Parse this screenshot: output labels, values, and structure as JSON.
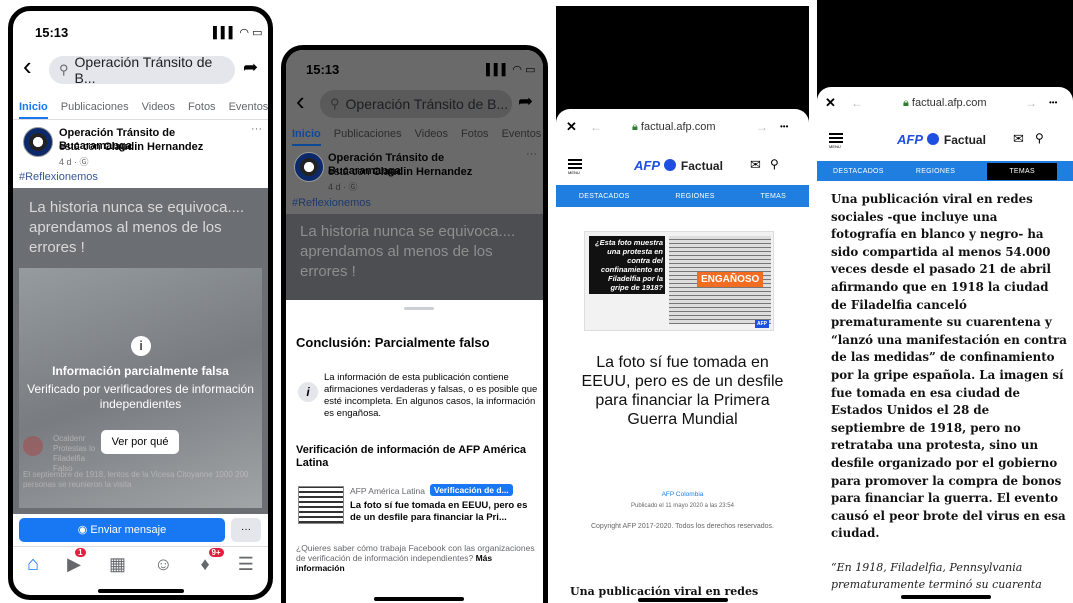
{
  "p1": {
    "time": "15:13",
    "status_icons": "▌▌▌ ◠ ▭",
    "back": "‹",
    "search": "Operación Tránsito de B...",
    "share": "➦",
    "tabs": [
      "Inicio",
      "Publicaciones",
      "Videos",
      "Fotos",
      "Eventos"
    ],
    "page_name": "Operación Tránsito de Bucaramanga",
    "with_prefix": "está con ",
    "with_name": "Claudin Hernandez",
    "meta": "4 d · Ⓖ",
    "more": "···",
    "hashtag": "#Reflexionemos",
    "post_text": "La historia nunca se equivoca.... aprendamos al menos de los errores !",
    "overlay_title": "Información parcialmente falsa",
    "overlay_sub": "Verificado por verificadores de información independientes",
    "see_why": "Ver por qué",
    "faded_1": "Ocaldenr Protestas lo Filadelfia Falso",
    "faded_2": "El septiembre de 1918, lentos de la Vicesa Citoyanne 1000 200 personas se reunieron la visita",
    "send_message": "Enviar mensaje",
    "send_more": "···",
    "badge1": "1",
    "badge2": "9+",
    "nav_icons": [
      "home-icon",
      "video-icon",
      "store-icon",
      "groups-icon",
      "bell-icon",
      "menu-icon"
    ]
  },
  "p2": {
    "time": "15:13",
    "status_icons": "▌▌▌ ◠ ▭",
    "back": "‹",
    "search": "Operación Tránsito de B...",
    "share": "➦",
    "tabs": [
      "Inicio",
      "Publicaciones",
      "Videos",
      "Fotos",
      "Eventos"
    ],
    "page_name": "Operación Tránsito de Bucaramanga",
    "with_prefix": "está con ",
    "with_name": "Claudin Hernandez",
    "meta": "4 d · Ⓖ",
    "more": "···",
    "hashtag": "#Reflexionemos",
    "post_text": "La historia nunca se equivoca.... aprendamos al menos de los errores !",
    "conclusion": "Conclusión: Parcialmente falso",
    "info_text": "La información de esta publicación contiene afirmaciones verdaderas y falsas, o es posible que esté incompleta. En algunos casos, la información es engañosa.",
    "verif_title": "Verificación de información de AFP América Latina",
    "source": "AFP América Latina",
    "badge": "Verificación de d...",
    "article": "La foto sí fue tomada en EEUU, pero es de un desfile para financiar la Pri...",
    "footer_q": "¿Quieres saber cómo trabaja Facebook con las organizaciones de verificación de información independientes? ",
    "footer_link": "Más información"
  },
  "p3": {
    "close": "✕",
    "back": "←",
    "url": "factual.afp.com",
    "fwd": "→",
    "more": "•••",
    "menu": "MENU",
    "logo_afp": "AFP",
    "logo_factual": "Factual",
    "nav": [
      "DESTACADOS",
      "REGIONES",
      "TEMAS"
    ],
    "img_claim": "¿Esta foto muestra una protesta en contra del confinamiento en Filadelfia por la gripe de 1918?",
    "img_stamp": "ENGAÑOSO",
    "img_tag": "AFP",
    "headline": "La foto sí fue tomada en EEUU, pero es de un desfile para financiar la Primera Guerra Mundial",
    "byline": "AFP Colombia",
    "published": "Publicado el 11 mayo 2020 a las 23:54",
    "copyright": "Copyright AFP 2017-2020. Todos los derechos reservados.",
    "lede": "Una publicación viral en redes"
  },
  "p4": {
    "close": "✕",
    "back": "←",
    "url": "factual.afp.com",
    "fwd": "→",
    "more": "•••",
    "menu": "MENU",
    "logo_afp": "AFP",
    "logo_factual": "Factual",
    "nav": [
      "DESTACADOS",
      "REGIONES",
      "TEMAS"
    ],
    "body": "Una publicación viral en redes sociales -que incluye una fotografía en blanco y negro- ha sido compartida al menos 54.000 veces desde el pasado 21 de abril afirmando que en 1918 la ciudad de Filadelfia canceló prematuramente su cuarentena y “lanzó una manifestación en contra de las medidas” de confinamiento por la gripe española. La imagen sí fue tomada en esa ciudad de Estados Unidos el 28 de septiembre de 1918, pero no retrataba una protesta, sino un desfile organizado por el gobierno para promover la compra de bonos para financiar la guerra. El evento causó el peor brote del virus en esa ciudad.",
    "quote": "“En 1918, Filadelfia, Pennsylvania prematuramente terminó su cuarenta"
  }
}
